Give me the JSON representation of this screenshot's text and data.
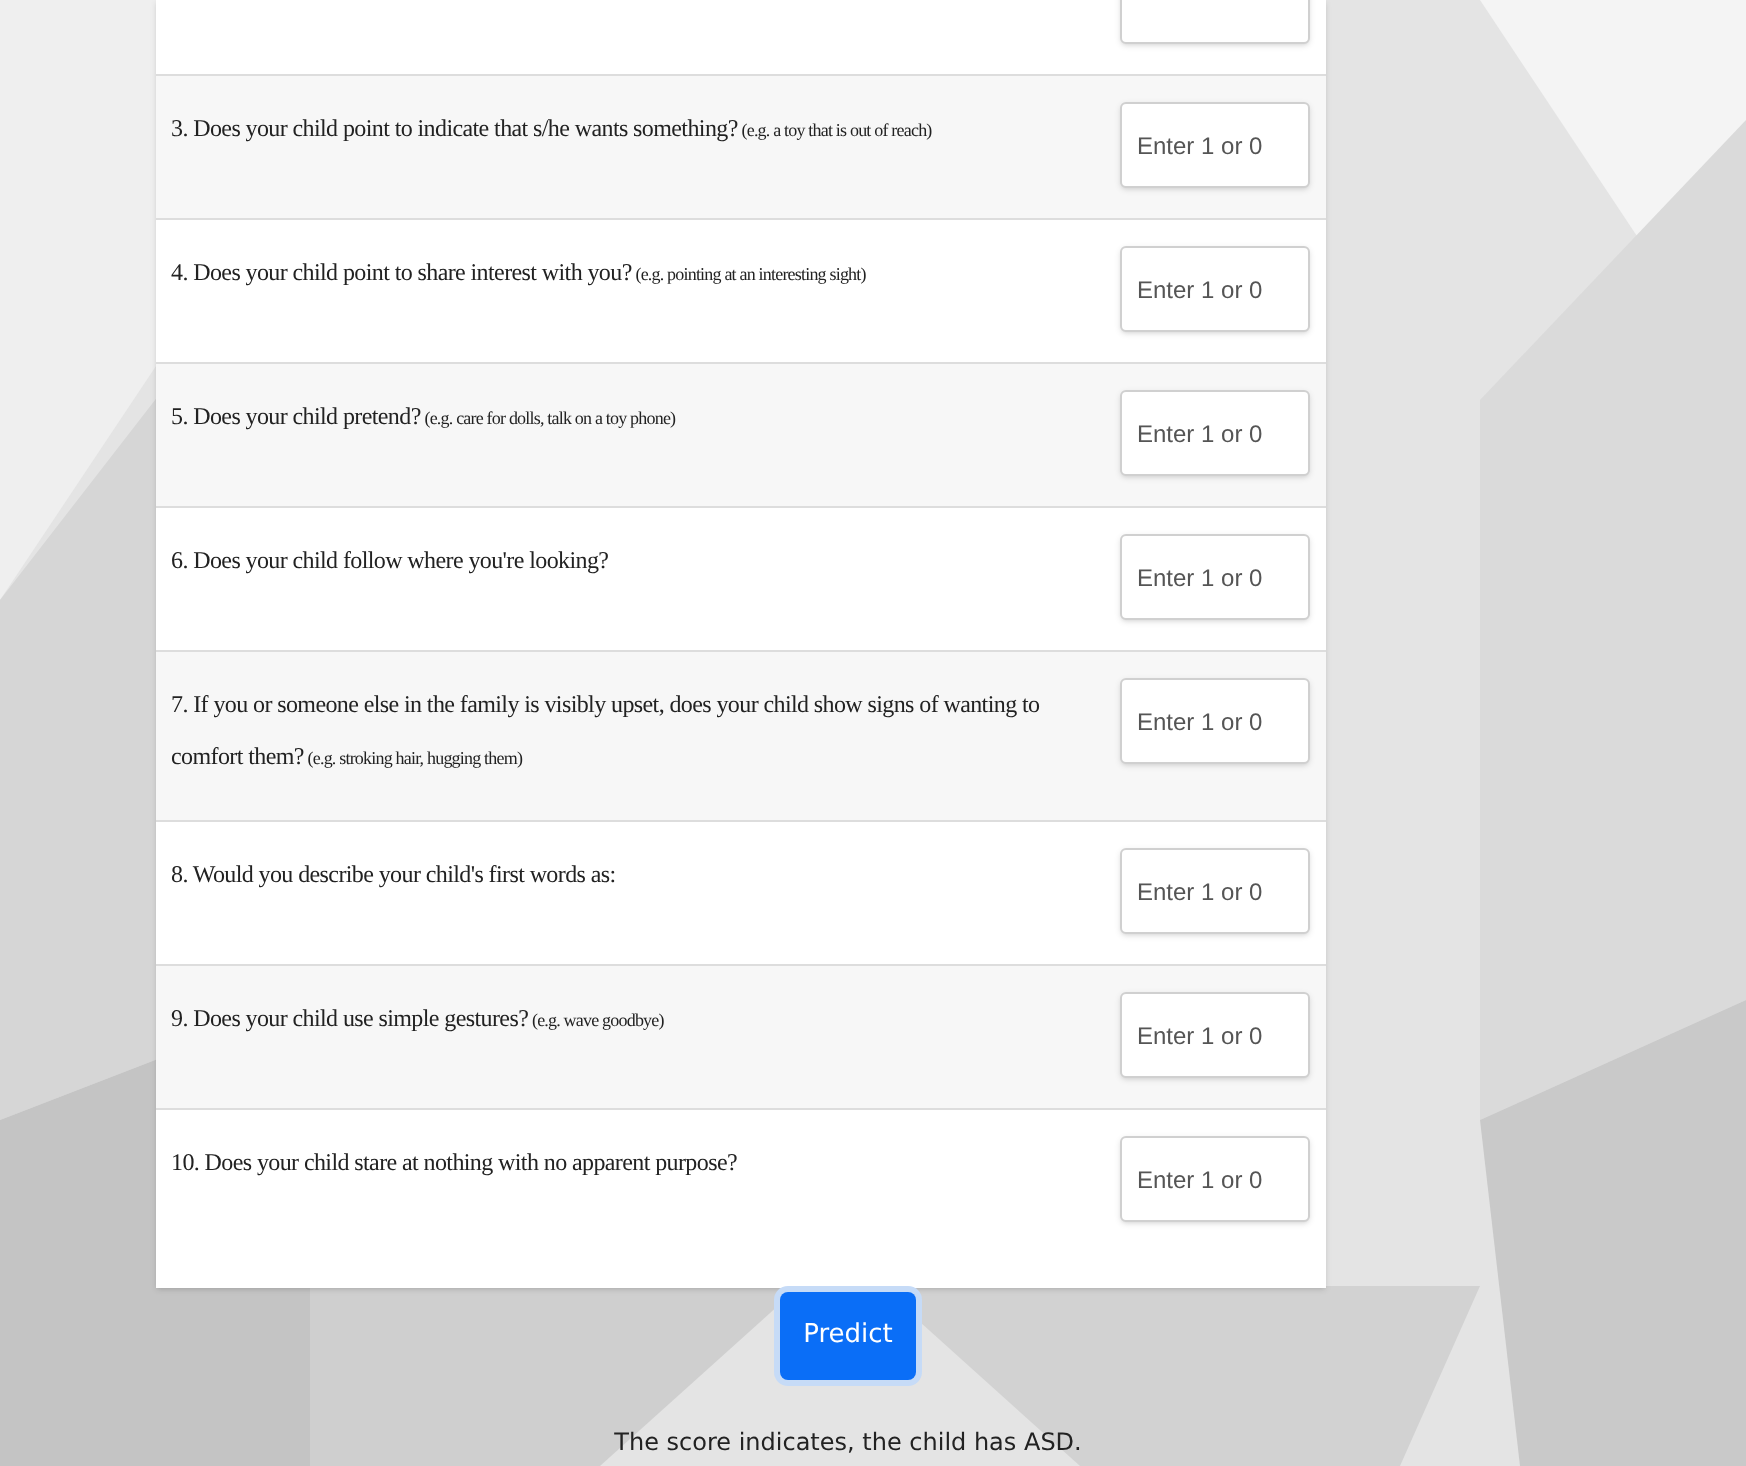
{
  "questions": [
    {
      "kind": "cut"
    },
    {
      "kind": "question",
      "text": "3. Does your child point to indicate that s/he wants something?",
      "hint": "(e.g. a toy that is out of reach)",
      "placeholder": "Enter 1 or 0"
    },
    {
      "kind": "question",
      "text": "4. Does your child point to share interest with you?",
      "hint": "(e.g. pointing at an interesting sight)",
      "placeholder": "Enter 1 or 0"
    },
    {
      "kind": "question",
      "text": "5. Does your child pretend?",
      "hint": "(e.g. care for dolls, talk on a toy phone)",
      "placeholder": "Enter 1 or 0"
    },
    {
      "kind": "question",
      "text": "6. Does your child follow where you're looking?",
      "placeholder": "Enter 1 or 0"
    },
    {
      "kind": "question",
      "text": "7. If you or someone else in the family is visibly upset, does your child show signs of wanting to comfort them?",
      "hint": "(e.g. stroking hair, hugging them)",
      "placeholder": "Enter 1 or 0"
    },
    {
      "kind": "question",
      "text": "8. Would you describe your child's first words as:",
      "placeholder": "Enter 1 or 0"
    },
    {
      "kind": "question",
      "text": "9. Does your child use simple gestures?",
      "hint": "(e.g. wave goodbye)",
      "placeholder": "Enter 1 or 0"
    },
    {
      "kind": "question",
      "text": "10. Does your child stare at nothing with no apparent purpose?",
      "placeholder": "Enter 1 or 0"
    }
  ],
  "button": "Predict",
  "result": "The score indicates, the child has ASD."
}
